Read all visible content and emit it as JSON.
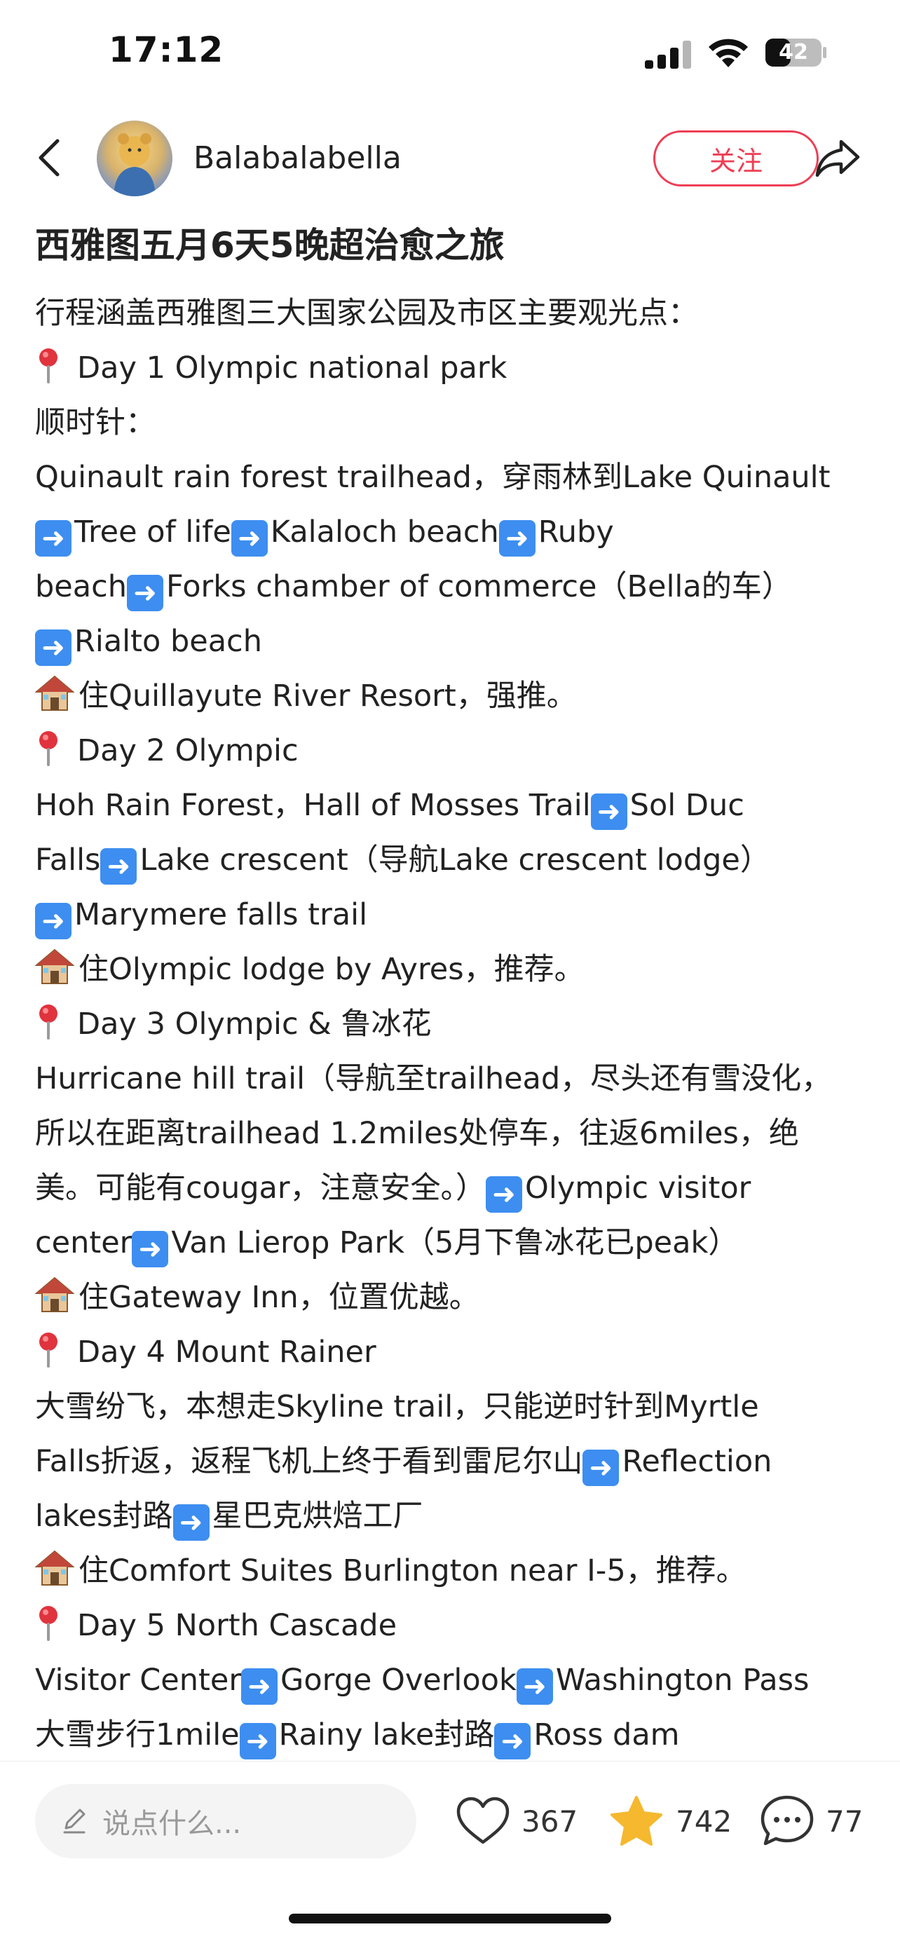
{
  "status_bar": {
    "time": "17:12",
    "battery": "42"
  },
  "header": {
    "username": "Balabalabella",
    "follow_label": "关注"
  },
  "post": {
    "title": "西雅图五月6天5晚超治愈之旅",
    "lines": [
      [
        {
          "t": "text",
          "v": "行程涵盖西雅图三大国家公园及市区主要观光点："
        }
      ],
      [
        {
          "t": "pin"
        },
        {
          "t": "text",
          "v": "Day 1 Olympic national park"
        }
      ],
      [
        {
          "t": "text",
          "v": "顺时针："
        }
      ],
      [
        {
          "t": "text",
          "v": "Quinault rain forest trailhead，穿雨林到Lake Quinault"
        }
      ],
      [
        {
          "t": "arrow"
        },
        {
          "t": "text",
          "v": "Tree of life"
        },
        {
          "t": "arrow"
        },
        {
          "t": "text",
          "v": "Kalaloch beach"
        },
        {
          "t": "arrow"
        },
        {
          "t": "text",
          "v": "Ruby"
        }
      ],
      [
        {
          "t": "text",
          "v": "beach"
        },
        {
          "t": "arrow"
        },
        {
          "t": "text",
          "v": "Forks chamber of commerce（Bella的车）"
        }
      ],
      [
        {
          "t": "arrow"
        },
        {
          "t": "text",
          "v": "Rialto beach"
        }
      ],
      [
        {
          "t": "house"
        },
        {
          "t": "text",
          "v": "住Quillayute River Resort，强推。"
        }
      ],
      [
        {
          "t": "pin"
        },
        {
          "t": "text",
          "v": "Day 2 Olympic"
        }
      ],
      [
        {
          "t": "text",
          "v": "Hoh Rain Forest，Hall of Mosses Trail"
        },
        {
          "t": "arrow"
        },
        {
          "t": "text",
          "v": "Sol Duc"
        }
      ],
      [
        {
          "t": "text",
          "v": "Falls"
        },
        {
          "t": "arrow"
        },
        {
          "t": "text",
          "v": "Lake crescent（导航Lake crescent lodge）"
        }
      ],
      [
        {
          "t": "arrow"
        },
        {
          "t": "text",
          "v": "Marymere falls trail"
        }
      ],
      [
        {
          "t": "house"
        },
        {
          "t": "text",
          "v": "住Olympic lodge by Ayres，推荐。"
        }
      ],
      [
        {
          "t": "pin"
        },
        {
          "t": "text",
          "v": "Day 3 Olympic & 鲁冰花"
        }
      ],
      [
        {
          "t": "text",
          "v": "Hurricane hill trail（导航至trailhead，尽头还有雪没化，"
        }
      ],
      [
        {
          "t": "text",
          "v": "所以在距离trailhead 1.2miles处停车，往返6miles，绝"
        }
      ],
      [
        {
          "t": "text",
          "v": "美。可能有cougar，注意安全。）"
        },
        {
          "t": "arrow"
        },
        {
          "t": "text",
          "v": "Olympic visitor"
        }
      ],
      [
        {
          "t": "text",
          "v": "center"
        },
        {
          "t": "arrow"
        },
        {
          "t": "text",
          "v": "Van Lierop Park（5月下鲁冰花已peak）"
        }
      ],
      [
        {
          "t": "house"
        },
        {
          "t": "text",
          "v": "住Gateway Inn，位置优越。"
        }
      ],
      [
        {
          "t": "pin"
        },
        {
          "t": "text",
          "v": "Day 4 Mount Rainer"
        }
      ],
      [
        {
          "t": "text",
          "v": "大雪纷飞，本想走Skyline trail，只能逆时针到Myrtle"
        }
      ],
      [
        {
          "t": "text",
          "v": "Falls折返，返程飞机上终于看到雷尼尔山"
        },
        {
          "t": "arrow"
        },
        {
          "t": "text",
          "v": "Reflection"
        }
      ],
      [
        {
          "t": "text",
          "v": "lakes封路"
        },
        {
          "t": "arrow"
        },
        {
          "t": "text",
          "v": "星巴克烘焙工厂"
        }
      ],
      [
        {
          "t": "house"
        },
        {
          "t": "text",
          "v": "住Comfort Suites Burlington near I-5，推荐。"
        }
      ],
      [
        {
          "t": "pin"
        },
        {
          "t": "text",
          "v": "Day 5 North Cascade"
        }
      ],
      [
        {
          "t": "text",
          "v": "Visitor Center"
        },
        {
          "t": "arrow"
        },
        {
          "t": "text",
          "v": "Gorge Overlook"
        },
        {
          "t": "arrow"
        },
        {
          "t": "text",
          "v": "Washington Pass"
        }
      ],
      [
        {
          "t": "text",
          "v": "大雪步行1mile"
        },
        {
          "t": "arrow"
        },
        {
          "t": "text",
          "v": "Rainy lake封路"
        },
        {
          "t": "arrow"
        },
        {
          "t": "text",
          "v": "Ross dam"
        }
      ]
    ]
  },
  "bottom_bar": {
    "comment_placeholder": "说点什么...",
    "likes": "367",
    "stars": "742",
    "comments": "77"
  },
  "colors": {
    "accent": "#ef3e55",
    "star": "#f5b82e",
    "arrow_bg": "#3d8ef0",
    "pin": "#e0333d"
  }
}
